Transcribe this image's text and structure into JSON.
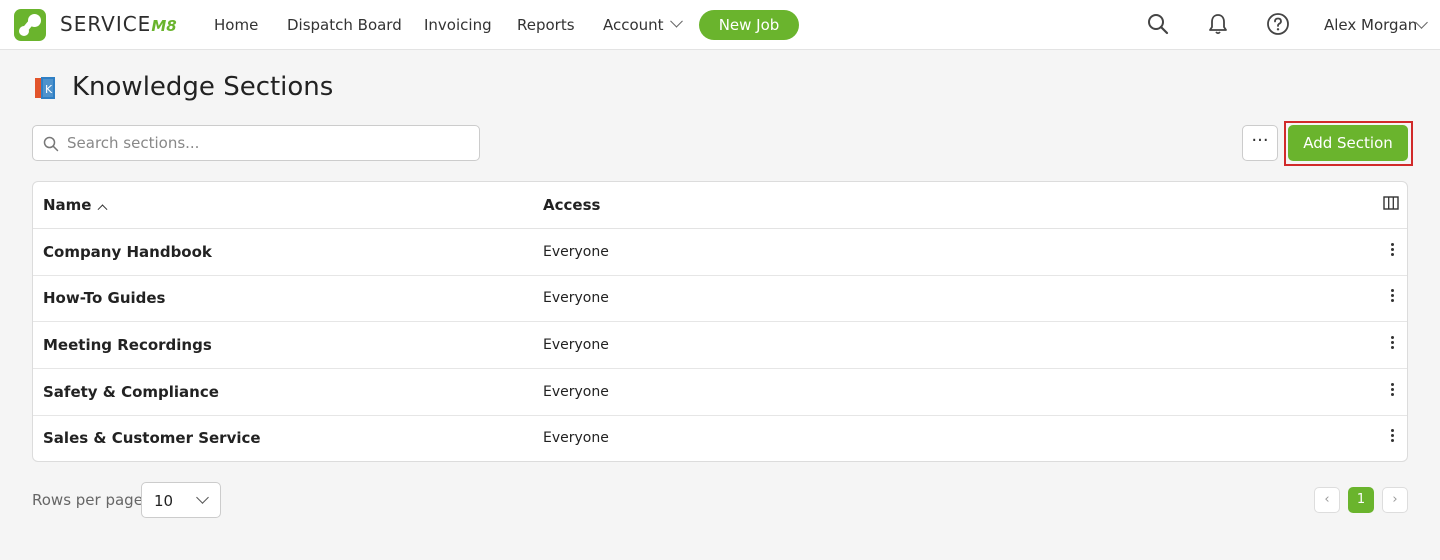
{
  "brand": {
    "name": "SERVICE",
    "suffix": "M8",
    "accent": "#6ab42d"
  },
  "nav": {
    "items": [
      {
        "label": "Home"
      },
      {
        "label": "Dispatch Board"
      },
      {
        "label": "Invoicing"
      },
      {
        "label": "Reports"
      },
      {
        "label": "Account"
      }
    ],
    "new_job": "New Job",
    "icons": [
      "search-icon",
      "bell-icon",
      "help-icon"
    ],
    "user": "Alex Morgan"
  },
  "page": {
    "title": "Knowledge Sections",
    "icon": "book-icon"
  },
  "toolbar": {
    "search_placeholder": "Search sections...",
    "more_label": "···",
    "add_label": "Add Section",
    "highlight_color": "#d12a2a"
  },
  "table": {
    "columns": [
      {
        "label": "Name",
        "sort": "ascending"
      },
      {
        "label": "Access"
      }
    ],
    "rows": [
      {
        "name": "Company Handbook",
        "access": "Everyone"
      },
      {
        "name": "How-To Guides",
        "access": "Everyone"
      },
      {
        "name": "Meeting Recordings",
        "access": "Everyone"
      },
      {
        "name": "Safety & Compliance",
        "access": "Everyone"
      },
      {
        "name": "Sales & Customer Service",
        "access": "Everyone"
      }
    ]
  },
  "footer": {
    "rows_per_page_label": "Rows per page",
    "rows_per_page_value": "10",
    "current_page": "1",
    "prev": "‹",
    "next": "›"
  }
}
